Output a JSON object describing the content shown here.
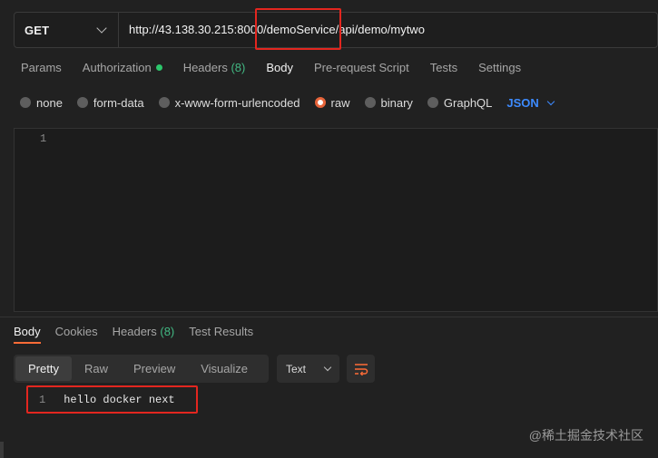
{
  "request": {
    "method": "GET",
    "url": "http://43.138.30.215:8000/demoService/api/demo/mytwo"
  },
  "request_tabs": [
    {
      "label": "Params"
    },
    {
      "label": "Authorization"
    },
    {
      "label": "Headers",
      "count": "(8)"
    },
    {
      "label": "Body"
    },
    {
      "label": "Pre-request Script"
    },
    {
      "label": "Tests"
    },
    {
      "label": "Settings"
    }
  ],
  "body_types": [
    "none",
    "form-data",
    "x-www-form-urlencoded",
    "raw",
    "binary",
    "GraphQL"
  ],
  "body_format": "JSON",
  "editor": {
    "line_number": "1"
  },
  "response_tabs": [
    {
      "label": "Body"
    },
    {
      "label": "Cookies"
    },
    {
      "label": "Headers",
      "count": "(8)"
    },
    {
      "label": "Test Results"
    }
  ],
  "view_modes": [
    "Pretty",
    "Raw",
    "Preview",
    "Visualize"
  ],
  "response_format": "Text",
  "response": {
    "line_number": "1",
    "text": "hello docker next"
  },
  "watermark": "@稀土掘金技术社区",
  "colors": {
    "accent": "#ff6c37",
    "highlight": "#e3261f",
    "json_link": "#3d8bff",
    "count": "#42b883"
  }
}
